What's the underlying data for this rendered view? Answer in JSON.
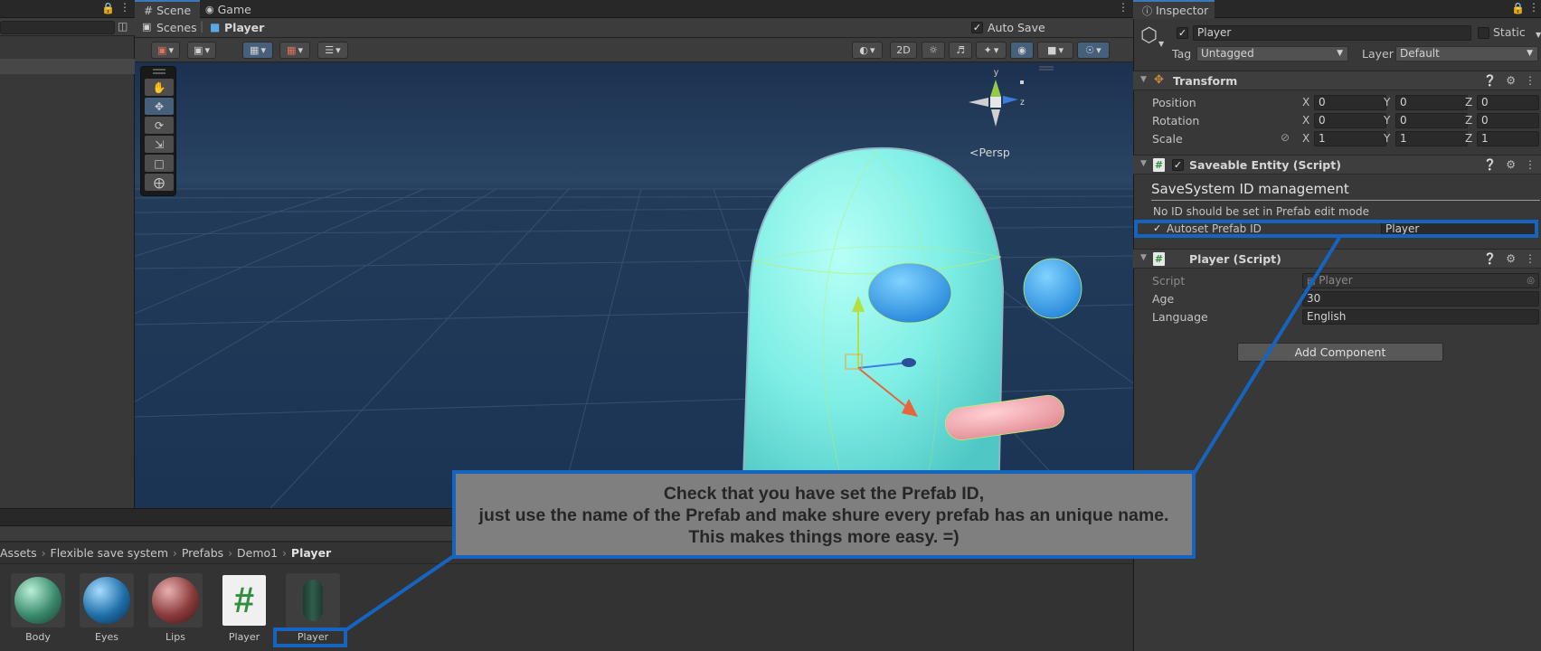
{
  "scene_view": {
    "tabs": [
      {
        "icon": "hash-icon",
        "label": "Scene"
      },
      {
        "icon": "gamepad-icon",
        "label": "Game"
      }
    ],
    "breadcrumb": {
      "root": "Scenes",
      "current": "Player"
    },
    "auto_save": {
      "label": "Auto Save",
      "checked": true
    },
    "toggle_2d": "2D",
    "gizmo": {
      "y": "y",
      "z": "z",
      "persp": "<Persp"
    }
  },
  "project": {
    "breadcrumb": [
      "Assets",
      "Flexible save system",
      "Prefabs",
      "Demo1",
      "Player"
    ],
    "assets": [
      {
        "name": "Body",
        "kind": "material",
        "color": "#3a8a6c"
      },
      {
        "name": "Eyes",
        "kind": "material",
        "color": "#1f6fa8"
      },
      {
        "name": "Lips",
        "kind": "material",
        "color": "#8a3a3a"
      },
      {
        "name": "Player",
        "kind": "script",
        "glyph": "#"
      },
      {
        "name": "Player",
        "kind": "prefab"
      }
    ]
  },
  "inspector": {
    "tab_label": "Inspector",
    "object": {
      "name": "Player",
      "static_label": "Static",
      "tag_label": "Tag",
      "tag_value": "Untagged",
      "layer_label": "Layer",
      "layer_value": "Default"
    },
    "transform": {
      "title": "Transform",
      "rows": [
        {
          "label": "Position",
          "x": "0",
          "y": "0",
          "z": "0"
        },
        {
          "label": "Rotation",
          "x": "0",
          "y": "0",
          "z": "0"
        },
        {
          "label": "Scale",
          "x": "1",
          "y": "1",
          "z": "1"
        }
      ],
      "axis_x": "X",
      "axis_y": "Y",
      "axis_z": "Z"
    },
    "saveable_entity": {
      "title": "Saveable Entity (Script)",
      "heading": "SaveSystem ID management",
      "note": "No ID should be set in Prefab edit mode",
      "autoset_label": "Autoset Prefab ID",
      "autoset_value": "Player"
    },
    "player_script": {
      "title": "Player (Script)",
      "rows": [
        {
          "label": "Script",
          "value": "Player"
        },
        {
          "label": "Age",
          "value": "30"
        },
        {
          "label": "Language",
          "value": "English"
        }
      ]
    },
    "add_component": "Add Component"
  },
  "callout": {
    "line1": "Check that you have set the Prefab ID,",
    "line2": "just use the name of the Prefab and make shure every prefab has an unique name.",
    "line3": "This makes things more easy. =)",
    "border_color": "#1565c0"
  }
}
